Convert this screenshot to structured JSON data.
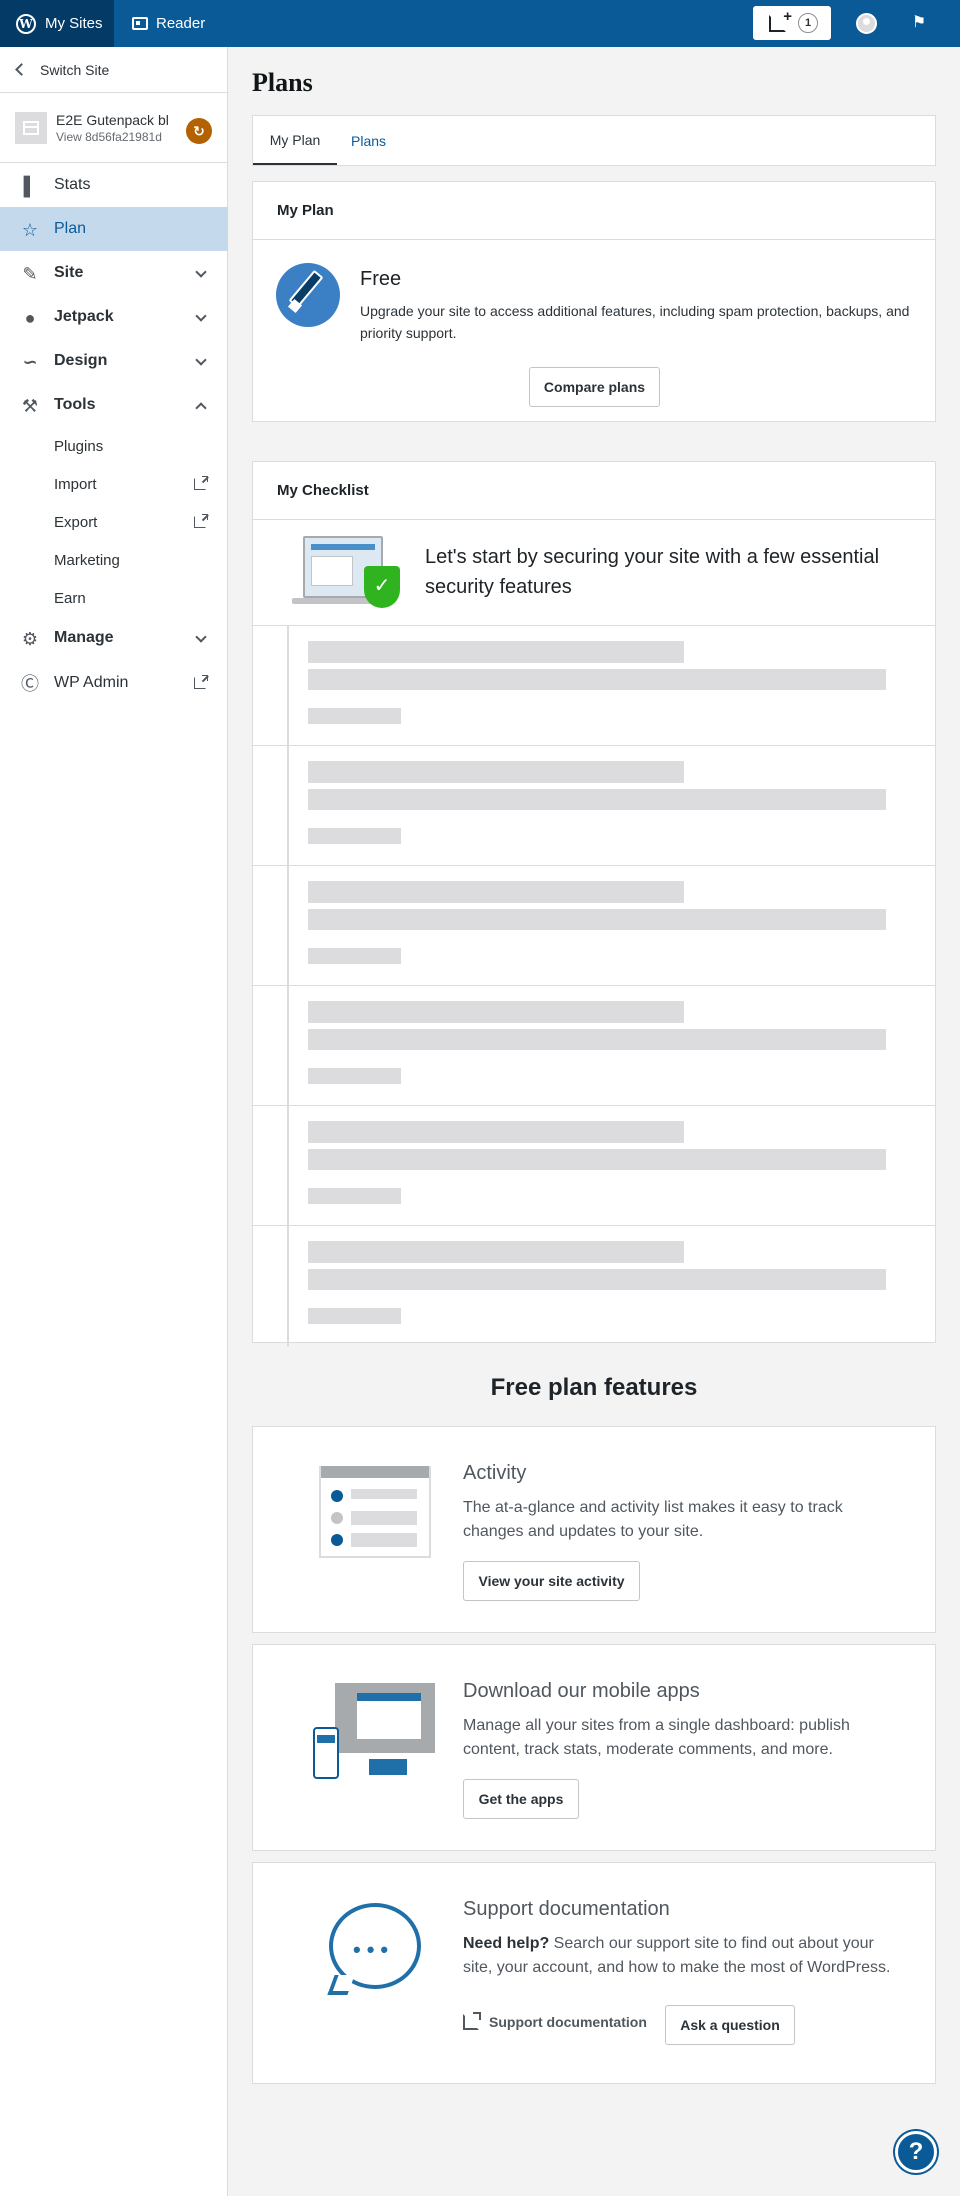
{
  "masterbar": {
    "my_sites": "My Sites",
    "reader": "Reader",
    "write_badge": "1"
  },
  "sidebar": {
    "switch_site": "Switch Site",
    "site_title": "E2E Gutenpack bl",
    "site_url": "View 8d56fa21981d",
    "items": {
      "stats": "Stats",
      "plan": "Plan",
      "site": "Site",
      "jetpack": "Jetpack",
      "design": "Design",
      "tools": "Tools",
      "plugins": "Plugins",
      "import": "Import",
      "export": "Export",
      "marketing": "Marketing",
      "earn": "Earn",
      "manage": "Manage",
      "wp_admin": "WP Admin"
    }
  },
  "main": {
    "page_title": "Plans",
    "tabs": [
      "My Plan",
      "Plans"
    ],
    "my_plan": {
      "heading": "My Plan",
      "plan_name": "Free",
      "description": "Upgrade your site to access additional features, including spam protection, backups, and priority support.",
      "compare_button": "Compare plans"
    },
    "checklist": {
      "heading": "My Checklist",
      "intro": "Let's start by securing your site with a few essential security features"
    },
    "features_title": "Free plan features",
    "features": [
      {
        "title": "Activity",
        "description": "The at-a-glance and activity list makes it easy to track changes and updates to your site.",
        "button": "View your site activity"
      },
      {
        "title": "Download our mobile apps",
        "description": "Manage all your sites from a single dashboard: publish content, track stats, moderate comments, and more.",
        "button": "Get the apps"
      },
      {
        "title": "Support documentation",
        "help_lead": "Need help?",
        "description": " Search our support site to find out about your site, your account, and how to make the most of WordPress.",
        "link": "Support documentation",
        "button": "Ask a question"
      }
    ]
  },
  "colors": {
    "masterbar": "#0b5a98",
    "masterbar_active": "#043a66",
    "sidebar_active": "#c5d9ed",
    "link": "#0b5a98",
    "shield": "#2fb41f"
  },
  "icons": [
    "wordpress-icon",
    "reader-icon",
    "write-icon",
    "avatar",
    "notifications-icon",
    "stats-icon",
    "star-icon",
    "pencil-icon",
    "jetpack-icon",
    "brush-icon",
    "wrench-icon",
    "gear-icon",
    "help-icon"
  ]
}
